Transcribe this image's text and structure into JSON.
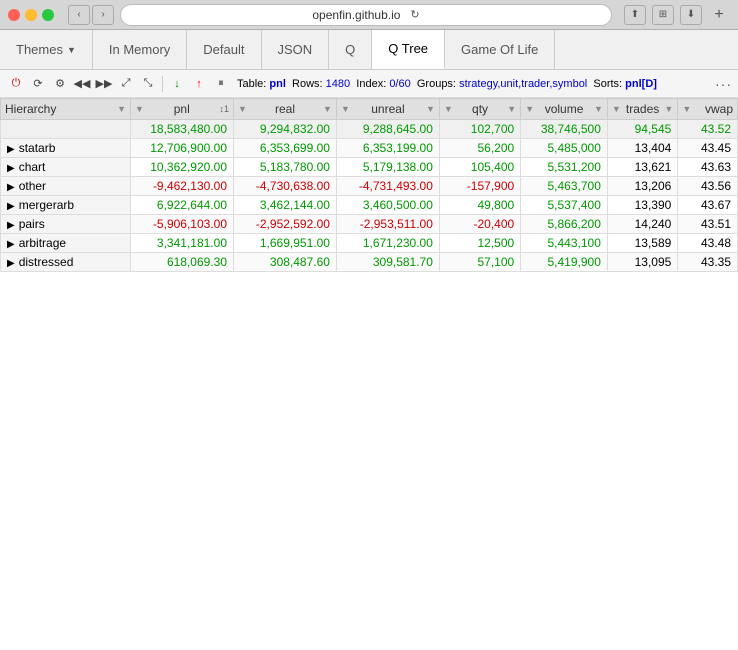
{
  "titlebar": {
    "url": "openfin.github.io",
    "reload_title": "Reload"
  },
  "tabs": [
    {
      "id": "themes",
      "label": "Themes",
      "has_dropdown": true,
      "active": false
    },
    {
      "id": "in-memory",
      "label": "In Memory",
      "active": false
    },
    {
      "id": "default",
      "label": "Default",
      "active": false
    },
    {
      "id": "json",
      "label": "JSON",
      "active": false
    },
    {
      "id": "q",
      "label": "Q",
      "active": false
    },
    {
      "id": "q-tree",
      "label": "Q Tree",
      "active": true
    },
    {
      "id": "game-of-life",
      "label": "Game Of Life",
      "active": false
    }
  ],
  "toolbar": {
    "dots": "···",
    "table_label": "Table:",
    "table_name": "pnl",
    "rows_label": "Rows:",
    "rows_value": "1480",
    "index_label": "Index:",
    "index_value": "0/60",
    "groups_label": "Groups:",
    "groups_value": "strategy,unit,trader,symbol",
    "sorts_label": "Sorts:",
    "sorts_value": "pnl[D]"
  },
  "columns": [
    {
      "id": "hierarchy",
      "label": "Hierarchy"
    },
    {
      "id": "pnl",
      "label": "pnl",
      "sort": "↕1"
    },
    {
      "id": "real",
      "label": "real"
    },
    {
      "id": "unreal",
      "label": "unreal"
    },
    {
      "id": "qty",
      "label": "qty"
    },
    {
      "id": "volume",
      "label": "volume"
    },
    {
      "id": "trades",
      "label": "trades"
    },
    {
      "id": "vwap",
      "label": "vwap"
    }
  ],
  "total_row": {
    "pnl": "18,583,480.00",
    "real": "9,294,832.00",
    "unreal": "9,288,645.00",
    "qty": "102,700",
    "volume": "38,746,500",
    "trades": "94,545",
    "vwap": "43.52"
  },
  "rows": [
    {
      "hierarchy": "statarb",
      "expandable": true,
      "pnl": "12,706,900.00",
      "real": "6,353,699.00",
      "unreal": "6,353,199.00",
      "qty": "56,200",
      "volume": "5,485,000",
      "trades": "13,404",
      "vwap": "43.45",
      "pnl_pos": true,
      "real_pos": true,
      "unreal_pos": true,
      "qty_pos": true
    },
    {
      "hierarchy": "chart",
      "expandable": true,
      "pnl": "10,362,920.00",
      "real": "5,183,780.00",
      "unreal": "5,179,138.00",
      "qty": "105,400",
      "volume": "5,531,200",
      "trades": "13,621",
      "vwap": "43.63",
      "pnl_pos": true,
      "real_pos": true,
      "unreal_pos": true,
      "qty_pos": true
    },
    {
      "hierarchy": "other",
      "expandable": true,
      "pnl": "-9,462,130.00",
      "real": "-4,730,638.00",
      "unreal": "-4,731,493.00",
      "qty": "-157,900",
      "volume": "5,463,700",
      "trades": "13,206",
      "vwap": "43.56",
      "pnl_pos": false,
      "real_pos": false,
      "unreal_pos": false,
      "qty_pos": false
    },
    {
      "hierarchy": "mergerarb",
      "expandable": true,
      "pnl": "6,922,644.00",
      "real": "3,462,144.00",
      "unreal": "3,460,500.00",
      "qty": "49,800",
      "volume": "5,537,400",
      "trades": "13,390",
      "vwap": "43.67",
      "pnl_pos": true,
      "real_pos": true,
      "unreal_pos": true,
      "qty_pos": true
    },
    {
      "hierarchy": "pairs",
      "expandable": true,
      "pnl": "-5,906,103.00",
      "real": "-2,952,592.00",
      "unreal": "-2,953,511.00",
      "qty": "-20,400",
      "volume": "5,866,200",
      "trades": "14,240",
      "vwap": "43.51",
      "pnl_pos": false,
      "real_pos": false,
      "unreal_pos": false,
      "qty_pos": false
    },
    {
      "hierarchy": "arbitrage",
      "expandable": true,
      "pnl": "3,341,181.00",
      "real": "1,669,951.00",
      "unreal": "1,671,230.00",
      "qty": "12,500",
      "volume": "5,443,100",
      "trades": "13,589",
      "vwap": "43.48",
      "pnl_pos": true,
      "real_pos": true,
      "unreal_pos": true,
      "qty_pos": true
    },
    {
      "hierarchy": "distressed",
      "expandable": true,
      "pnl": "618,069.30",
      "real": "308,487.60",
      "unreal": "309,581.70",
      "qty": "57,100",
      "volume": "5,419,900",
      "trades": "13,095",
      "vwap": "43.35",
      "pnl_pos": true,
      "real_pos": true,
      "unreal_pos": true,
      "qty_pos": true
    }
  ]
}
